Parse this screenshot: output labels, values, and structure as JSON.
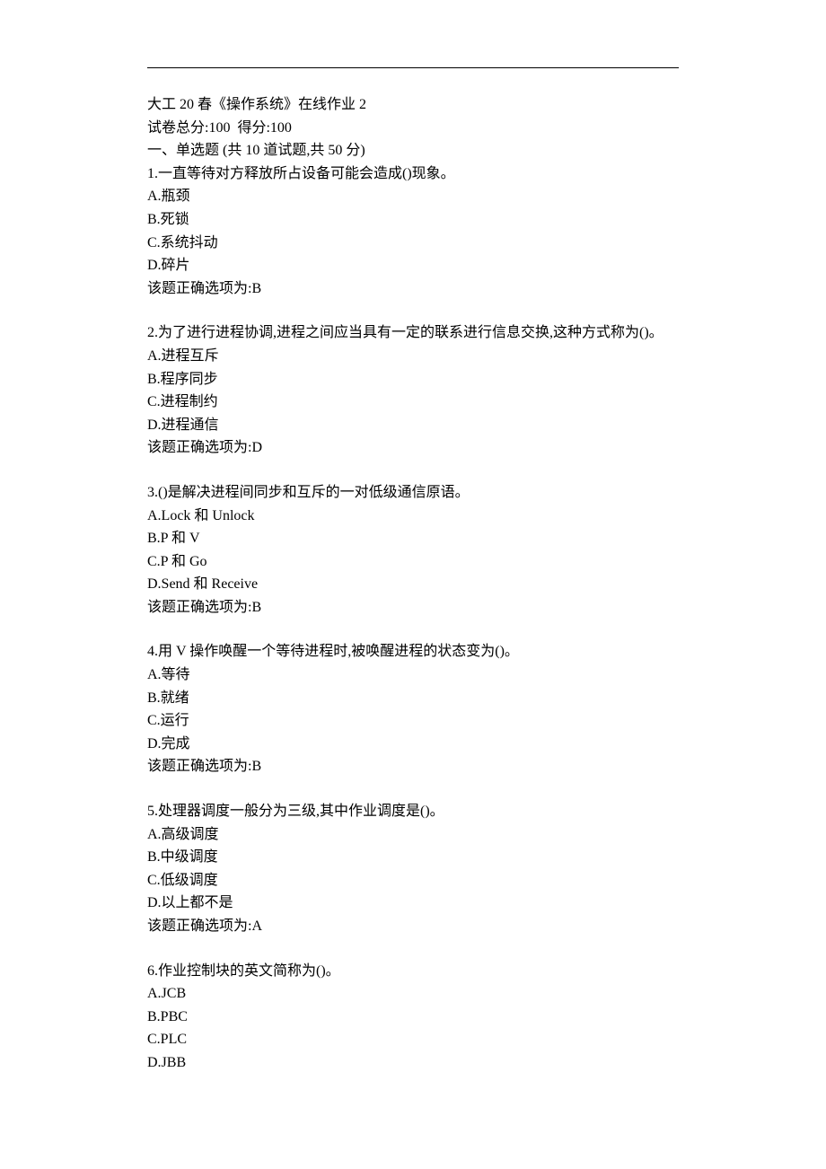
{
  "header": {
    "title": "大工 20 春《操作系统》在线作业 2",
    "score_line": "试卷总分:100  得分:100",
    "section_header": "一、单选题 (共 10 道试题,共 50 分)"
  },
  "questions": [
    {
      "stem": "1.一直等待对方释放所占设备可能会造成()现象。",
      "options": [
        "A.瓶颈",
        "B.死锁",
        "C.系统抖动",
        "D.碎片"
      ],
      "answer": "该题正确选项为:B"
    },
    {
      "stem": "2.为了进行进程协调,进程之间应当具有一定的联系进行信息交换,这种方式称为()。",
      "options": [
        "A.进程互斥",
        "B.程序同步",
        "C.进程制约",
        "D.进程通信"
      ],
      "answer": "该题正确选项为:D"
    },
    {
      "stem": "3.()是解决进程间同步和互斥的一对低级通信原语。",
      "options": [
        "A.Lock 和 Unlock",
        "B.P 和 V",
        "C.P 和 Go",
        "D.Send 和 Receive"
      ],
      "answer": "该题正确选项为:B"
    },
    {
      "stem": "4.用 V 操作唤醒一个等待进程时,被唤醒进程的状态变为()。",
      "options": [
        "A.等待",
        "B.就绪",
        "C.运行",
        "D.完成"
      ],
      "answer": "该题正确选项为:B"
    },
    {
      "stem": "5.处理器调度一般分为三级,其中作业调度是()。",
      "options": [
        "A.高级调度",
        "B.中级调度",
        "C.低级调度",
        "D.以上都不是"
      ],
      "answer": "该题正确选项为:A"
    },
    {
      "stem": "6.作业控制块的英文简称为()。",
      "options": [
        "A.JCB",
        "B.PBC",
        "C.PLC",
        "D.JBB"
      ],
      "answer": ""
    }
  ]
}
